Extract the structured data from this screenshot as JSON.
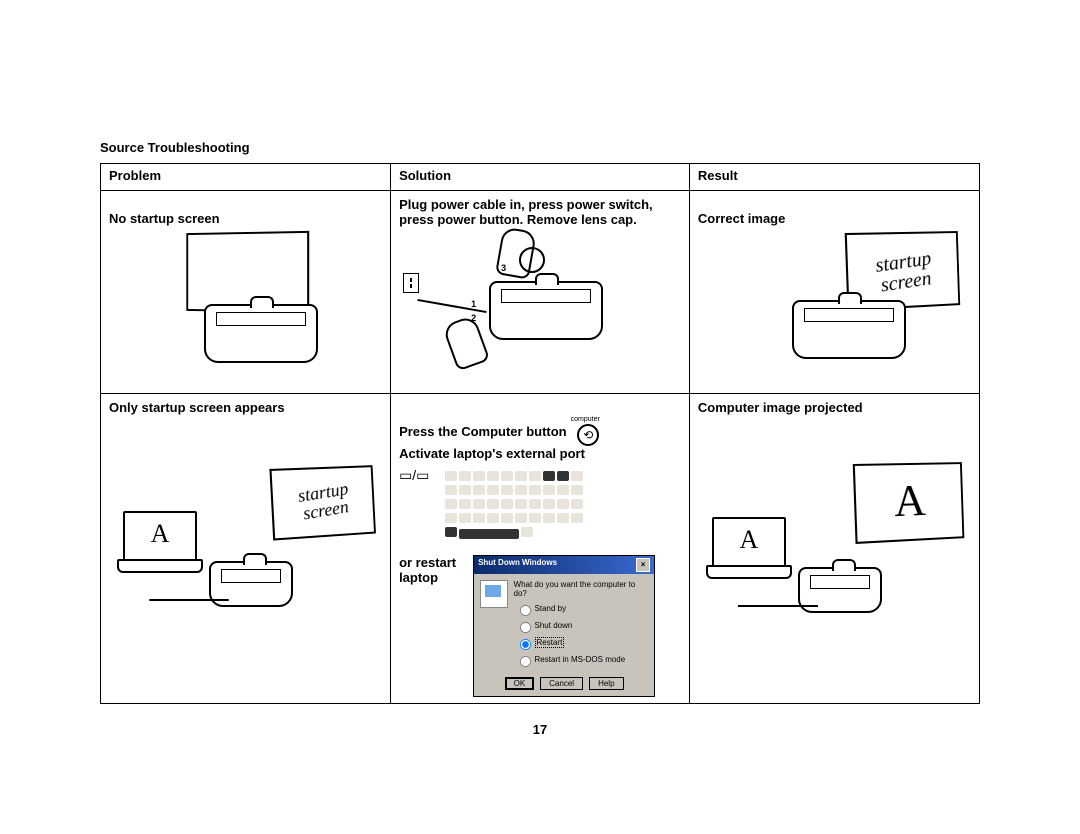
{
  "section_title": "Source Troubleshooting",
  "headers": {
    "problem": "Problem",
    "solution": "Solution",
    "result": "Result"
  },
  "rows": [
    {
      "problem": "No startup screen",
      "solution": "Plug power cable in, press power switch, press power button. Remove lens cap.",
      "solution_steps": {
        "s1": "1",
        "s2": "2",
        "s3": "3"
      },
      "result": "Correct image",
      "result_screen_text": "startup screen"
    },
    {
      "problem": "Only startup screen appears",
      "problem_screen_text": "startup screen",
      "problem_laptop_letter": "A",
      "solution_line1": "Press the Computer button",
      "solution_button_label": "computer",
      "solution_line2": "Activate laptop's external port",
      "solution_or": "or restart laptop",
      "result": "Computer image projected",
      "result_laptop_letter": "A",
      "result_screen_letter": "A"
    }
  ],
  "dialog": {
    "title": "Shut Down Windows",
    "prompt": "What do you want the computer to do?",
    "opt1": "Stand by",
    "opt2": "Shut down",
    "opt3": "Restart",
    "opt4": "Restart in MS-DOS mode",
    "btn_ok": "OK",
    "btn_cancel": "Cancel",
    "btn_help": "Help"
  },
  "page_number": "17"
}
